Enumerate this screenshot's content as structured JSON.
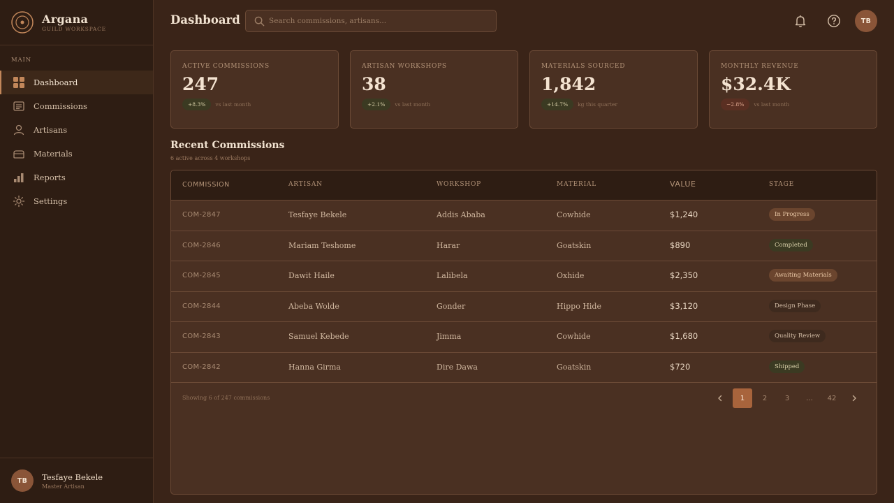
{
  "brand": {
    "name": "Argana",
    "subtitle": "GUILD WORKSPACE"
  },
  "nav": {
    "section": "MAIN",
    "items": [
      {
        "label": "Dashboard",
        "icon": "grid-icon",
        "active": true
      },
      {
        "label": "Commissions",
        "icon": "folder-icon"
      },
      {
        "label": "Artisans",
        "icon": "user-icon"
      },
      {
        "label": "Materials",
        "icon": "box-icon"
      },
      {
        "label": "Reports",
        "icon": "bar-chart-icon"
      },
      {
        "label": "Settings",
        "icon": "gear-icon"
      }
    ]
  },
  "user": {
    "initials": "TB",
    "name": "Tesfaye Bekele",
    "role": "Master Artisan"
  },
  "header": {
    "title": "Dashboard",
    "search_placeholder": "Search commissions, artisans..."
  },
  "stats": [
    {
      "label": "ACTIVE COMMISSIONS",
      "value": "247",
      "delta": "+8.3%",
      "note": "vs last month",
      "positive": true
    },
    {
      "label": "ARTISAN WORKSHOPS",
      "value": "38",
      "delta": "+2.1%",
      "note": "vs last month",
      "positive": true
    },
    {
      "label": "MATERIALS SOURCED",
      "value": "1,842",
      "delta": "+14.7%",
      "note": "kg this quarter",
      "positive": true
    },
    {
      "label": "MONTHLY REVENUE",
      "value": "$32.4K",
      "delta": "−2.8%",
      "note": "vs last month",
      "positive": false
    }
  ],
  "section": {
    "title": "Recent Commissions",
    "subtitle": "6 active across 4 workshops"
  },
  "table": {
    "headers": {
      "commission": "COMMISSION",
      "artisan": "ARTISAN",
      "workshop": "WORKSHOP",
      "material": "MATERIAL",
      "value": "VALUE",
      "stage": "STAGE"
    },
    "rows": [
      {
        "commission": "COM-2847",
        "artisan": "Tesfaye Bekele",
        "workshop": "Addis Ababa",
        "material": "Cowhide",
        "value": "$1,240",
        "stage": "In Progress"
      },
      {
        "commission": "COM-2846",
        "artisan": "Mariam Teshome",
        "workshop": "Harar",
        "material": "Goatskin",
        "value": "$890",
        "stage": "Completed"
      },
      {
        "commission": "COM-2845",
        "artisan": "Dawit Haile",
        "workshop": "Lalibela",
        "material": "Oxhide",
        "value": "$2,350",
        "stage": "Awaiting Materials"
      },
      {
        "commission": "COM-2844",
        "artisan": "Abeba Wolde",
        "workshop": "Gonder",
        "material": "Hippo Hide",
        "value": "$3,120",
        "stage": "Design Phase"
      },
      {
        "commission": "COM-2843",
        "artisan": "Samuel Kebede",
        "workshop": "Jimma",
        "material": "Cowhide",
        "value": "$1,680",
        "stage": "Quality Review"
      },
      {
        "commission": "COM-2842",
        "artisan": "Hanna Girma",
        "workshop": "Dire Dawa",
        "material": "Goatskin",
        "value": "$720",
        "stage": "Shipped"
      }
    ],
    "footer": "Showing 6 of 247 commissions",
    "pages": [
      "1",
      "2",
      "3",
      "...",
      "42"
    ],
    "current_page": "1"
  }
}
